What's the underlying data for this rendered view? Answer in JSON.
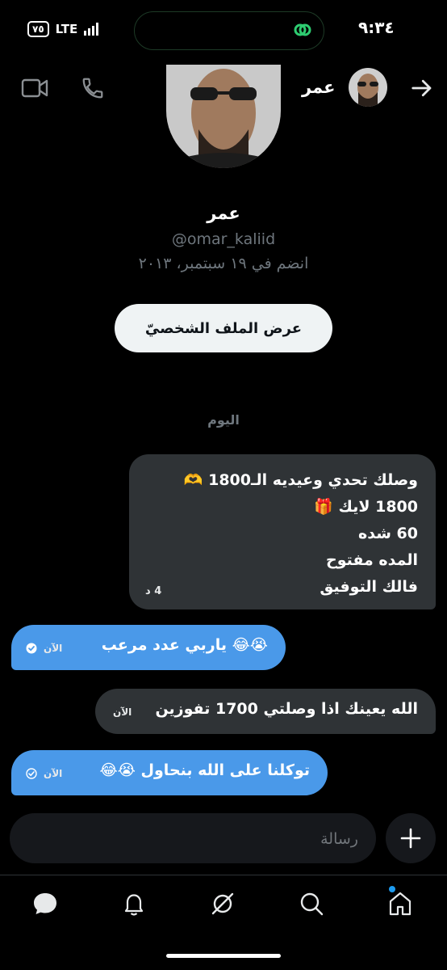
{
  "status_bar": {
    "time": "٩:٣٤",
    "network": "LTE",
    "battery": "٧٥"
  },
  "header": {
    "contact_name": "عمر"
  },
  "profile": {
    "name": "عمر",
    "handle": "@omar_kaliid",
    "joined": "انضم في ١٩ سبتمبر، ٢٠١٣",
    "view_profile_label": "عرض الملف الشخصيّ"
  },
  "conversation": {
    "day_label": "اليوم",
    "messages": [
      {
        "side": "received",
        "lines": [
          "وصلك تحدي وعيديه الـ1800 🫶",
          "1800 لايك 🎁",
          "60 شده",
          "المده مفتوح",
          "فالك التوفيق"
        ],
        "time": "4 د"
      },
      {
        "side": "sent",
        "text": "😭😂 ياربي عدد مرعب",
        "time": "الآن"
      },
      {
        "side": "received",
        "text": "الله يعينك اذا وصلتي 1700 تفوزين",
        "time": "الآن"
      },
      {
        "side": "sent",
        "text": "توكلنا على الله بنحاول 😭😂",
        "time": "الآن"
      }
    ]
  },
  "composer": {
    "placeholder": "رسالة"
  },
  "nav": {
    "items": [
      {
        "name": "messages-icon"
      },
      {
        "name": "notifications-icon"
      },
      {
        "name": "grok-icon"
      },
      {
        "name": "search-icon"
      },
      {
        "name": "home-icon"
      }
    ]
  },
  "colors": {
    "sent_bubble": "#4a99e9",
    "received_bubble": "#2f3336",
    "accent": "#1d9bf0"
  }
}
